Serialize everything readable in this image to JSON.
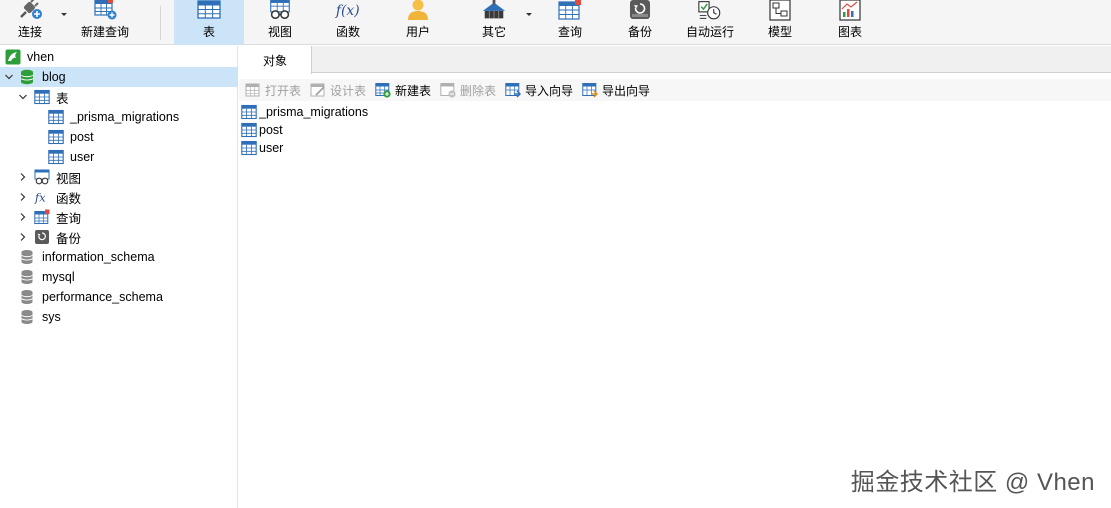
{
  "toolbar": {
    "connect": "连接",
    "new_query": "新建查询",
    "table": "表",
    "view": "视图",
    "function": "函数",
    "user": "用户",
    "other": "其它",
    "query": "查询",
    "backup": "备份",
    "auto_run": "自动运行",
    "model": "模型",
    "chart": "图表",
    "active": "table"
  },
  "sidebar": {
    "connection": "vhen",
    "databases": [
      "blog",
      "information_schema",
      "mysql",
      "performance_schema",
      "sys"
    ],
    "selected_db": "blog",
    "tables_group": "表",
    "tables": [
      "_prisma_migrations",
      "post",
      "user"
    ],
    "groups": [
      "视图",
      "函数",
      "查询",
      "备份"
    ]
  },
  "main": {
    "tab": "对象",
    "actions": {
      "open_table": "打开表",
      "design_table": "设计表",
      "new_table": "新建表",
      "delete_table": "删除表",
      "import_wizard": "导入向导",
      "export_wizard": "导出向导"
    },
    "objects": [
      "_prisma_migrations",
      "post",
      "user"
    ]
  },
  "icons": {
    "connect": "plug-icon",
    "new_query": "new-query-icon",
    "table": "table-icon",
    "view": "view-icon",
    "function": "function-icon",
    "user": "user-icon",
    "other": "other-icon",
    "query": "query-icon",
    "backup": "backup-icon",
    "auto_run": "auto-run-icon",
    "model": "model-icon",
    "chart": "chart-icon"
  },
  "colors": {
    "accent": "#cce4f7",
    "db_green": "#2e9e3a",
    "table_blue": "#2e6fb8"
  },
  "watermark": "掘金技术社区 @ Vhen"
}
